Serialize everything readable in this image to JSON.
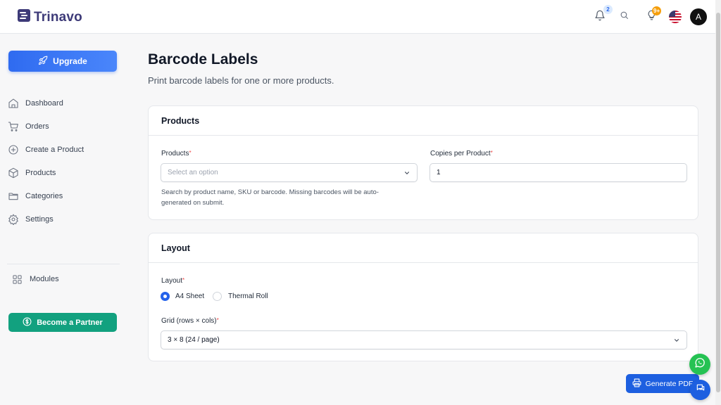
{
  "app": {
    "name": "Trinavo",
    "logo_icon": "trinavo-logo-icon"
  },
  "header": {
    "notifications_count": "2",
    "ideas_count": "9+",
    "avatar_initial": "A",
    "icons": [
      "bell-icon",
      "search-icon",
      "lightbulb-icon",
      "us-flag-icon"
    ]
  },
  "sidebar": {
    "upgrade_label": "Upgrade",
    "items": [
      {
        "label": "Dashboard",
        "icon": "home-icon"
      },
      {
        "label": "Orders",
        "icon": "cart-icon"
      },
      {
        "label": "Create a Product",
        "icon": "plus-circle-icon"
      },
      {
        "label": "Products",
        "icon": "box-icon"
      },
      {
        "label": "Categories",
        "icon": "folder-icon"
      },
      {
        "label": "Settings",
        "icon": "gear-icon"
      }
    ],
    "modules_label": "Modules",
    "partner_label": "Become a Partner"
  },
  "page": {
    "title": "Barcode Labels",
    "subtitle": "Print barcode labels for one or more products."
  },
  "products_card": {
    "title": "Products",
    "products_label": "Products",
    "products_placeholder": "Select an option",
    "products_help": "Search by product name, SKU or barcode. Missing barcodes will be auto-generated on submit.",
    "copies_label": "Copies per Product",
    "copies_value": "1"
  },
  "layout_card": {
    "title": "Layout",
    "layout_label": "Layout",
    "options": [
      {
        "label": "A4 Sheet",
        "selected": true
      },
      {
        "label": "Thermal Roll",
        "selected": false
      }
    ],
    "grid_label": "Grid (rows × cols)",
    "grid_value": "3 × 8 (24 / page)"
  },
  "actions": {
    "generate_label": "Generate PDF"
  },
  "colors": {
    "primary": "#2563eb",
    "partner": "#12a17f",
    "brand": "#3d3a78",
    "whatsapp": "#25c253"
  }
}
